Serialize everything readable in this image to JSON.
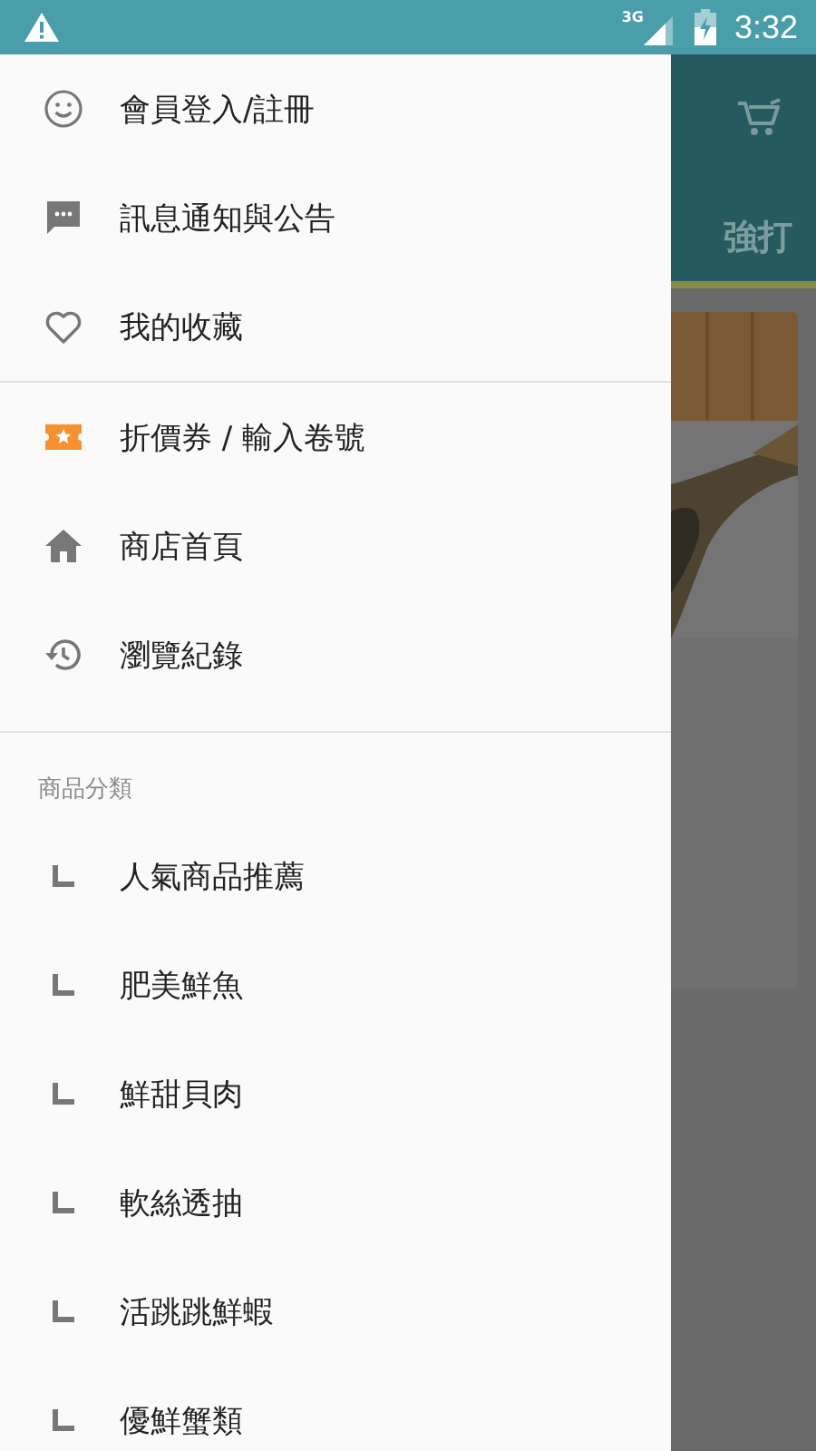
{
  "status_bar": {
    "network": "3G",
    "time": "3:32"
  },
  "drawer": {
    "sections": [
      {
        "items": [
          {
            "label": "會員登入/註冊"
          },
          {
            "label": "訊息通知與公告"
          },
          {
            "label": "我的收藏"
          }
        ]
      },
      {
        "items": [
          {
            "label": "折價券 / 輸入卷號"
          },
          {
            "label": "商店首頁"
          },
          {
            "label": "瀏覽紀錄"
          }
        ]
      }
    ],
    "categories": {
      "title": "商品分類",
      "items": [
        {
          "label": "人氣商品推薦"
        },
        {
          "label": "肥美鮮魚"
        },
        {
          "label": "鮮甜貝肉"
        },
        {
          "label": "軟絲透抽"
        },
        {
          "label": "活跳跳鮮蝦"
        },
        {
          "label": "優鮮蟹類"
        }
      ]
    }
  },
  "background": {
    "title": "強打"
  }
}
